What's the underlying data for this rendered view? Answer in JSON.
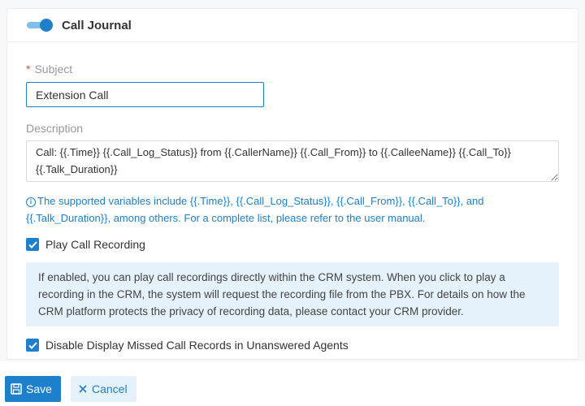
{
  "header": {
    "title": "Call Journal",
    "toggle_on": true
  },
  "subject": {
    "label": "Subject",
    "required_mark": "*",
    "value": "Extension Call"
  },
  "description": {
    "label": "Description",
    "value": "Call: {{.Time}} {{.Call_Log_Status}} from {{.CallerName}} {{.Call_From}} to {{.CalleeName}} {{.Call_To}} {{.Talk_Duration}}"
  },
  "hint": {
    "icon": "info-icon",
    "text": "The supported variables include {{.Time}}, {{.Call_Log_Status}}, {{.Call_From}}, {{.Call_To}}, and {{.Talk_Duration}}, among others. For a complete list, please refer to the user manual."
  },
  "play_recording": {
    "label": "Play Call Recording",
    "checked": true,
    "info": "If enabled, you can play call recordings directly within the CRM system. When you click to play a recording in the CRM, the system will request the recording file from the PBX. For details on how the CRM platform protects the privacy of recording data, please contact your CRM provider."
  },
  "disable_missed": {
    "label": "Disable Display Missed Call Records in Unanswered Agents",
    "checked": true
  },
  "footer": {
    "save_label": "Save",
    "cancel_label": "Cancel"
  },
  "colors": {
    "primary": "#1e7fcb",
    "info_bg": "#e6f2fb",
    "required": "#e35040"
  }
}
